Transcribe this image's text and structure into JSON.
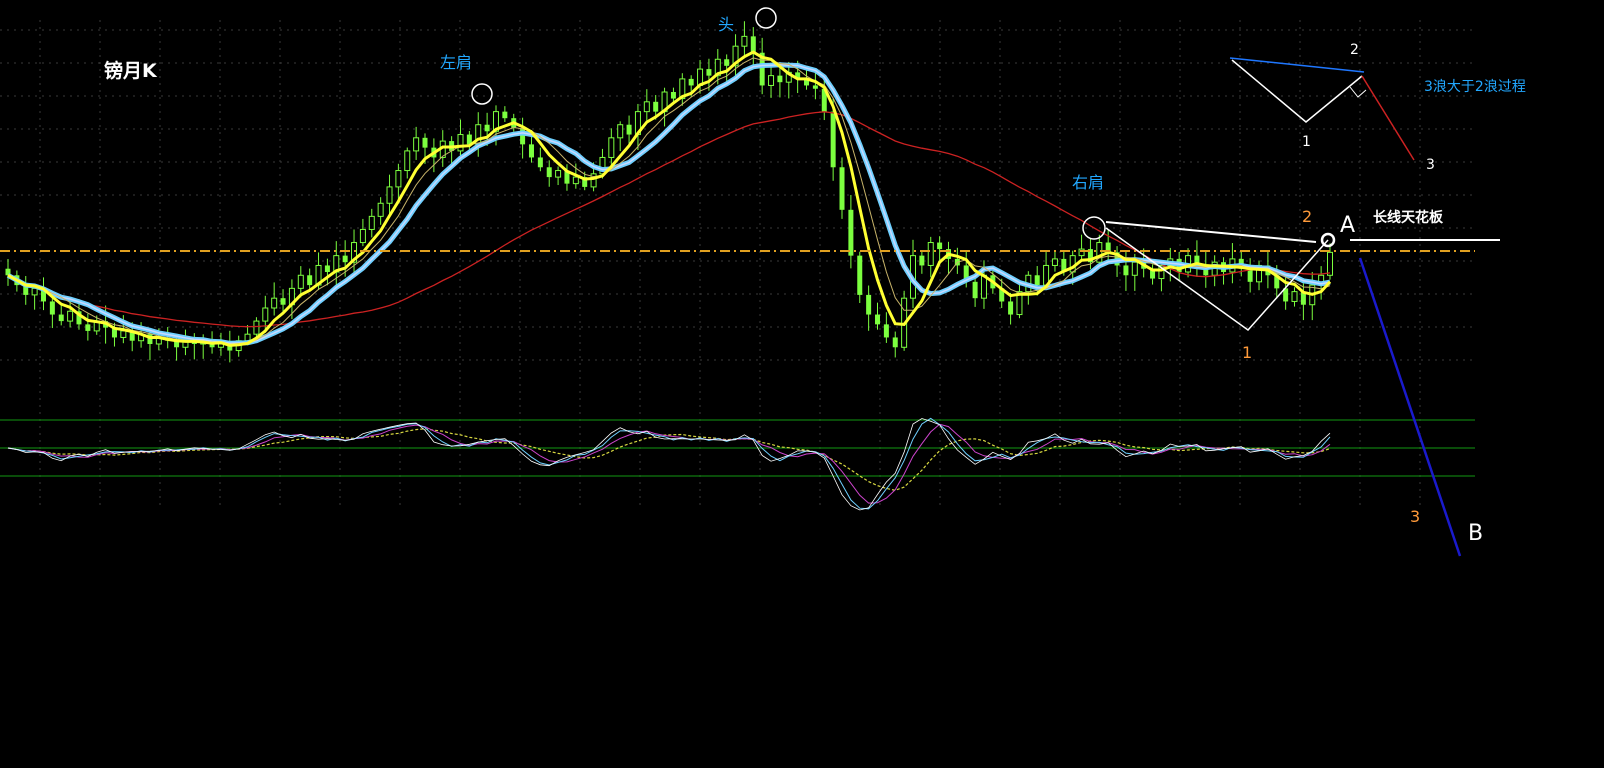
{
  "chart_data": {
    "type": "candlestick",
    "title": "镑月K",
    "colors": {
      "background": "#000000",
      "grid": "#3a3a3a",
      "candle": "#7cff3f",
      "ma_fast": "#ffff33",
      "ma_thin": "#c8b46a",
      "ma_band_outer": "#6fd0ff",
      "ma_band_inner": "#c8d8ff",
      "ma_long": "#cc2222",
      "ceiling": "#e0a020",
      "label_blue": "#22a8ff",
      "label_orange": "#ff9a3a",
      "label_white": "#ffffff",
      "wave_blue": "#1f77ff",
      "wave_red": "#cc2222",
      "osc_green": "#0f7a0f"
    },
    "pattern_labels": {
      "left_shoulder": "左肩",
      "head": "头",
      "right_shoulder": "右肩",
      "ceiling_label": "长线天花板",
      "point_a": "A",
      "point_b": "B",
      "wave1": "1",
      "wave2": "2",
      "wave3": "3"
    },
    "inset": {
      "caption": "3浪大于2浪过程",
      "wave1": "1",
      "wave2": "2",
      "wave3": "3"
    },
    "closes": [
      1.52,
      1.49,
      1.46,
      1.48,
      1.44,
      1.4,
      1.38,
      1.41,
      1.37,
      1.35,
      1.38,
      1.36,
      1.33,
      1.35,
      1.32,
      1.34,
      1.31,
      1.33,
      1.32,
      1.3,
      1.33,
      1.31,
      1.32,
      1.3,
      1.31,
      1.29,
      1.32,
      1.34,
      1.38,
      1.42,
      1.45,
      1.43,
      1.48,
      1.52,
      1.49,
      1.55,
      1.53,
      1.58,
      1.56,
      1.62,
      1.66,
      1.7,
      1.74,
      1.79,
      1.84,
      1.9,
      1.94,
      1.91,
      1.88,
      1.93,
      1.9,
      1.95,
      1.92,
      1.98,
      1.96,
      2.02,
      2.0,
      1.97,
      1.92,
      1.88,
      1.85,
      1.82,
      1.84,
      1.8,
      1.82,
      1.79,
      1.83,
      1.88,
      1.94,
      1.98,
      1.95,
      2.02,
      2.05,
      2.02,
      2.08,
      2.06,
      2.12,
      2.1,
      2.15,
      2.13,
      2.18,
      2.16,
      2.22,
      2.25,
      2.2,
      2.1,
      2.13,
      2.11,
      2.14,
      2.12,
      2.1,
      2.09,
      2.02,
      1.85,
      1.72,
      1.58,
      1.46,
      1.4,
      1.37,
      1.33,
      1.3,
      1.45,
      1.58,
      1.55,
      1.62,
      1.6,
      1.57,
      1.55,
      1.5,
      1.45,
      1.52,
      1.48,
      1.44,
      1.4,
      1.47,
      1.52,
      1.49,
      1.55,
      1.57,
      1.53,
      1.58,
      1.6,
      1.56,
      1.62,
      1.59,
      1.55,
      1.52,
      1.56,
      1.54,
      1.51,
      1.55,
      1.57,
      1.53,
      1.58,
      1.55,
      1.52,
      1.56,
      1.53,
      1.57,
      1.54,
      1.5,
      1.55,
      1.52,
      1.48,
      1.44,
      1.47,
      1.43,
      1.49,
      1.52,
      1.59
    ]
  }
}
